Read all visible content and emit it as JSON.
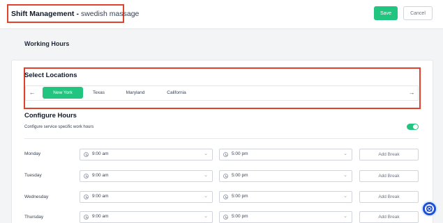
{
  "header": {
    "title": "Shift Management",
    "separator": "-",
    "service": "swedish massage",
    "save_label": "Save",
    "cancel_label": "Cancel"
  },
  "section_title": "Working Hours",
  "locations": {
    "title": "Select Locations",
    "left_arrow": "←",
    "right_arrow": "→",
    "items": [
      "New York",
      "Texas",
      "Maryland",
      "California"
    ],
    "active": "New York"
  },
  "configure": {
    "title": "Configure Hours",
    "subtitle": "Configure service specific work hours",
    "toggle_on": true
  },
  "schedule": {
    "add_break_label": "Add Break",
    "rows": [
      {
        "day": "Monday",
        "start": "9:00 am",
        "end": "5:00 pm"
      },
      {
        "day": "Tuesday",
        "start": "9:00 am",
        "end": "5:00 pm"
      },
      {
        "day": "Wednesday",
        "start": "9:00 am",
        "end": "5:00 pm"
      },
      {
        "day": "Thursday",
        "start": "9:00 am",
        "end": "5:00 pm"
      }
    ]
  },
  "colors": {
    "accent": "#22c57f",
    "highlight": "#e0412a",
    "help_fab": "#1d4ed8"
  },
  "icons": {
    "clock": "clock-icon",
    "chevron": "chevron-down-icon",
    "help": "lifebuoy-icon"
  }
}
